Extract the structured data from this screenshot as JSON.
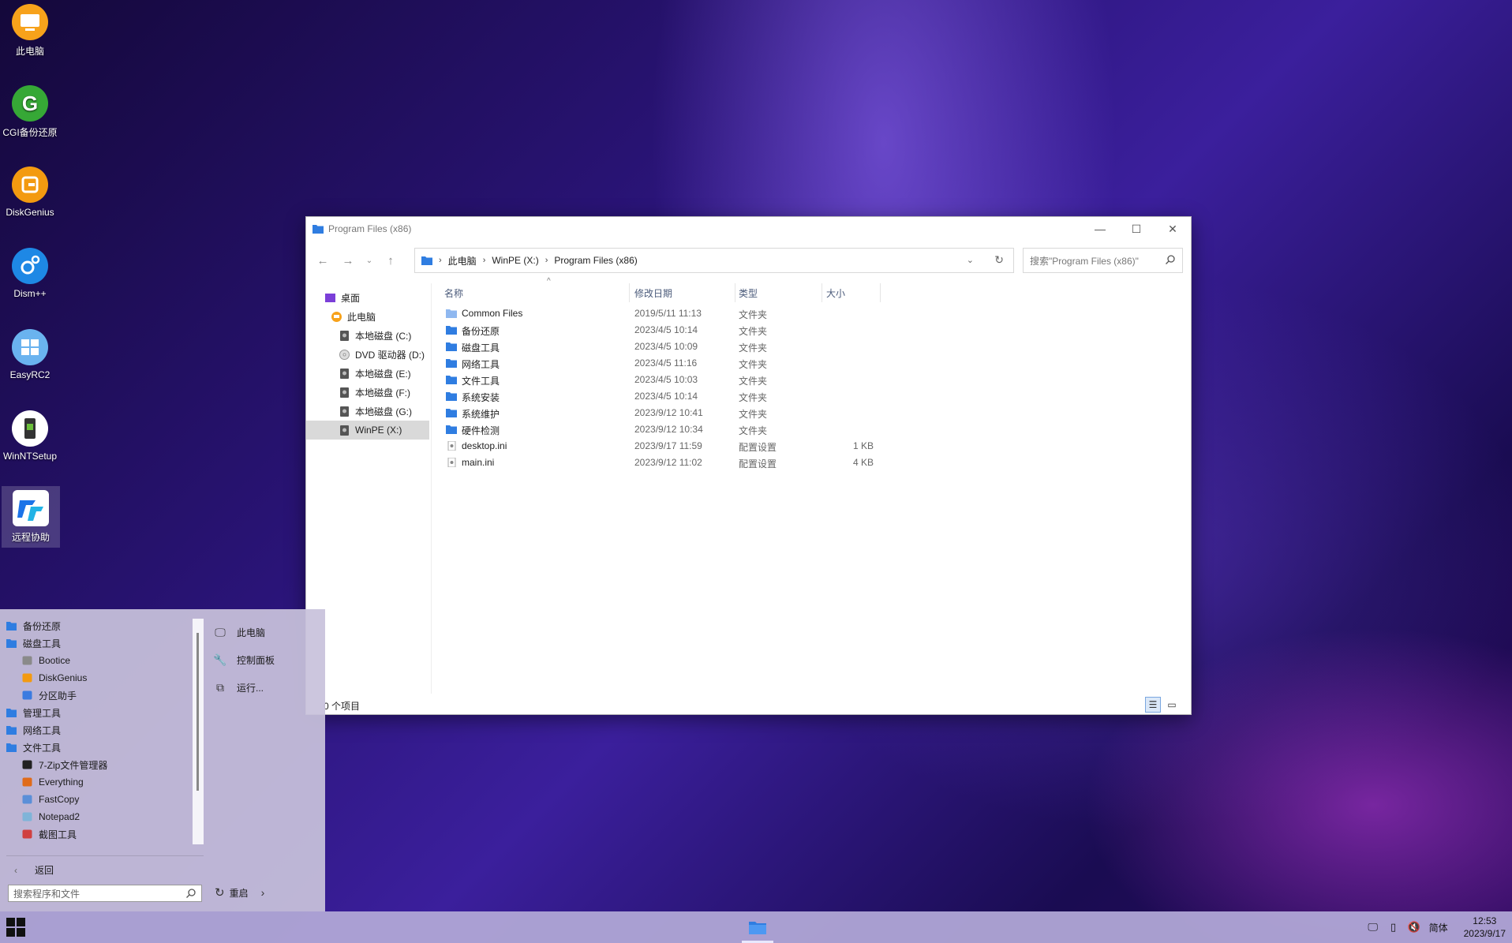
{
  "desktop": {
    "icons": [
      {
        "label": "此电脑",
        "color": "#f7a21b"
      },
      {
        "label": "CGI备份还原",
        "color": "#36a836"
      },
      {
        "label": "DiskGenius",
        "color": "#f39a10"
      },
      {
        "label": "Dism++",
        "color": "#1e88e5"
      },
      {
        "label": "EasyRC2",
        "color": "#4fa3e8"
      },
      {
        "label": "WinNTSetup",
        "color": "#ffffff"
      },
      {
        "label": "远程协助",
        "color": "#ffffff"
      }
    ]
  },
  "explorer": {
    "title": "Program Files (x86)",
    "breadcrumb": [
      "此电脑",
      "WinPE (X:)",
      "Program Files (x86)"
    ],
    "search_placeholder": "搜索\"Program Files (x86)\"",
    "tree": [
      {
        "label": "桌面",
        "type": "desktop"
      },
      {
        "label": "此电脑",
        "type": "pc"
      },
      {
        "label": "本地磁盘 (C:)",
        "type": "disk"
      },
      {
        "label": "DVD 驱动器 (D:)",
        "type": "dvd"
      },
      {
        "label": "本地磁盘 (E:)",
        "type": "disk"
      },
      {
        "label": "本地磁盘 (F:)",
        "type": "disk"
      },
      {
        "label": "本地磁盘 (G:)",
        "type": "disk"
      },
      {
        "label": "WinPE (X:)",
        "type": "disk",
        "selected": true
      }
    ],
    "columns": {
      "name": "名称",
      "modified": "修改日期",
      "type": "类型",
      "size": "大小"
    },
    "files": [
      {
        "name": "Common Files",
        "modified": "2019/5/11 11:13",
        "type": "文件夹",
        "size": "",
        "kind": "folder-light"
      },
      {
        "name": "备份还原",
        "modified": "2023/4/5 10:14",
        "type": "文件夹",
        "size": "",
        "kind": "folder"
      },
      {
        "name": "磁盘工具",
        "modified": "2023/4/5 10:09",
        "type": "文件夹",
        "size": "",
        "kind": "folder"
      },
      {
        "name": "网络工具",
        "modified": "2023/4/5 11:16",
        "type": "文件夹",
        "size": "",
        "kind": "folder"
      },
      {
        "name": "文件工具",
        "modified": "2023/4/5 10:03",
        "type": "文件夹",
        "size": "",
        "kind": "folder"
      },
      {
        "name": "系统安装",
        "modified": "2023/4/5 10:14",
        "type": "文件夹",
        "size": "",
        "kind": "folder"
      },
      {
        "name": "系统维护",
        "modified": "2023/9/12 10:41",
        "type": "文件夹",
        "size": "",
        "kind": "folder"
      },
      {
        "name": "硬件检测",
        "modified": "2023/9/12 10:34",
        "type": "文件夹",
        "size": "",
        "kind": "folder"
      },
      {
        "name": "desktop.ini",
        "modified": "2023/9/17 11:59",
        "type": "配置设置",
        "size": "1 KB",
        "kind": "ini"
      },
      {
        "name": "main.ini",
        "modified": "2023/9/12 11:02",
        "type": "配置设置",
        "size": "4 KB",
        "kind": "ini"
      }
    ],
    "status": "0 个项目"
  },
  "start_menu": {
    "items": [
      {
        "label": "备份还原",
        "kind": "folder",
        "sub": false
      },
      {
        "label": "磁盘工具",
        "kind": "folder",
        "sub": false
      },
      {
        "label": "Bootice",
        "kind": "app",
        "sub": true,
        "color": "#8a8a8a"
      },
      {
        "label": "DiskGenius",
        "kind": "app",
        "sub": true,
        "color": "#f39a10"
      },
      {
        "label": "分区助手",
        "kind": "app",
        "sub": true,
        "color": "#3b7be0"
      },
      {
        "label": "管理工具",
        "kind": "folder",
        "sub": false
      },
      {
        "label": "网络工具",
        "kind": "folder",
        "sub": false
      },
      {
        "label": "文件工具",
        "kind": "folder",
        "sub": false
      },
      {
        "label": "7-Zip文件管理器",
        "kind": "app",
        "sub": true,
        "color": "#222222"
      },
      {
        "label": "Everything",
        "kind": "app",
        "sub": true,
        "color": "#e06b1a"
      },
      {
        "label": "FastCopy",
        "kind": "app",
        "sub": true,
        "color": "#5b8fd8"
      },
      {
        "label": "Notepad2",
        "kind": "app",
        "sub": true,
        "color": "#7fb4d8"
      },
      {
        "label": "截图工具",
        "kind": "app",
        "sub": true,
        "color": "#d04040"
      }
    ],
    "back_label": "返回",
    "search_placeholder": "搜索程序和文件",
    "right_items": [
      {
        "label": "此电脑",
        "icon": "monitor-icon"
      },
      {
        "label": "控制面板",
        "icon": "wrench-icon"
      },
      {
        "label": "运行...",
        "icon": "run-icon"
      }
    ],
    "restart_label": "重启"
  },
  "taskbar": {
    "ime_label": "简体",
    "time": "12:53",
    "date": "2023/9/17"
  }
}
